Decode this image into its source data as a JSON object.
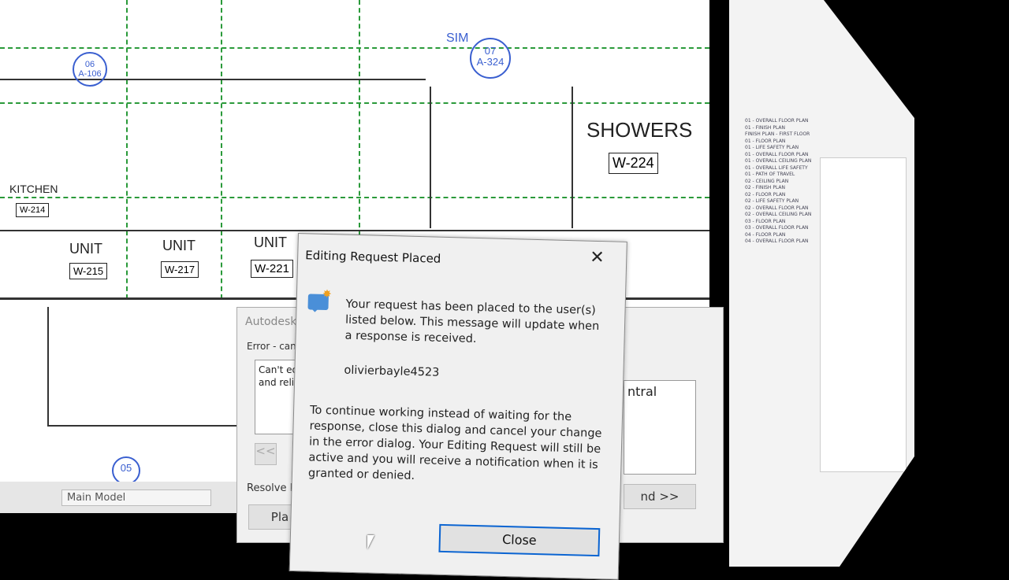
{
  "plan": {
    "showers": "SHOWERS",
    "showers_tag": "W-224",
    "units": [
      {
        "label": "UNIT",
        "tag": "W-215"
      },
      {
        "label": "UNIT",
        "tag": "W-217"
      },
      {
        "label": "UNIT",
        "tag": "W-221"
      }
    ],
    "kitchen": "KITCHEN",
    "kitchen_tag": "W-214",
    "sim": "SIM",
    "callouts": [
      {
        "num": "07",
        "sheet": "A-324"
      },
      {
        "num": "06",
        "sheet": "A-106"
      },
      {
        "num": "05",
        "sheet": ""
      }
    ]
  },
  "status_bar": {
    "model": "Main Model"
  },
  "back_dialog": {
    "title": "Autodesk R",
    "group": "Error - can",
    "message": "Can't edit\nand relinc",
    "right_text": "ntral",
    "prev_btn": "<<",
    "resolve_label": "Resolve First",
    "place_btn": "Pla",
    "expand_btn": "nd >>"
  },
  "dialog": {
    "title": "Editing Request Placed",
    "close_x": "✕",
    "message": "Your request has been placed to the user(s) listed below. This message will update when a response is received.",
    "user": "olivierbayle4523",
    "instructions": "To continue working instead of waiting for the response, close this dialog and cancel your change in the error dialog.  Your Editing Request will still be active and you will receive a notification when it is granted or denied.",
    "close_button": "Close"
  }
}
